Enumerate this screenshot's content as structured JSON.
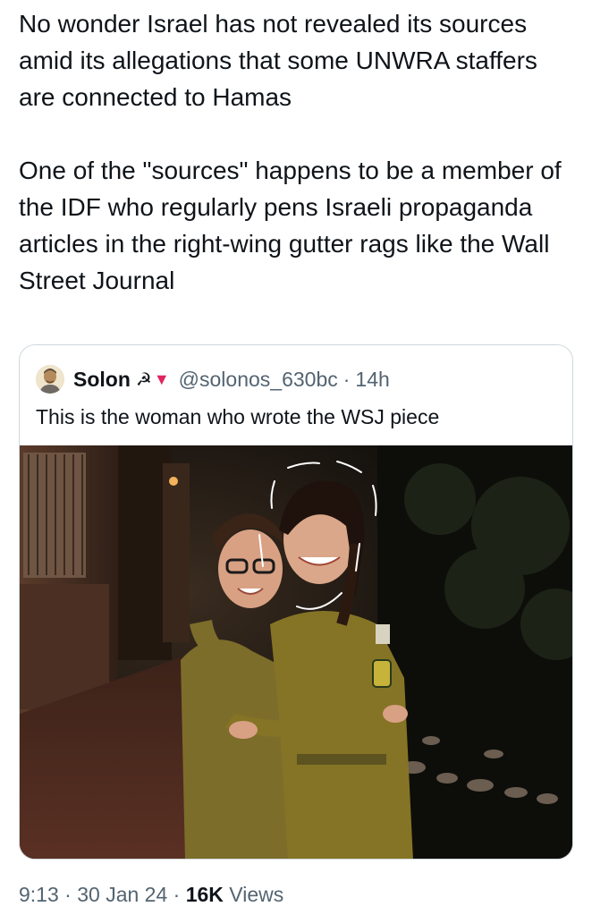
{
  "post": {
    "paragraph_1": "No wonder Israel has not revealed its sources amid its allegations that some UNWRA staffers are connected to Hamas",
    "paragraph_2": "One of the \"sources\" happens to be a member of the IDF who regularly pens Israeli propaganda articles in the right-wing gutter rags like the Wall Street Journal"
  },
  "quote": {
    "author_name": "Solon",
    "flair_symbols": "☭",
    "flair_triangle": "▼",
    "handle": "@solonos_630bc",
    "separator": "·",
    "time": "14h",
    "text": "This is the woman who wrote the WSJ piece",
    "image_icon": "photo-of-two-soldiers-hugging"
  },
  "meta": {
    "time": "9:13",
    "separator_1": "·",
    "date": "30 Jan 24",
    "separator_2": "·",
    "views_count": "16K",
    "views_label": "Views"
  },
  "colors": {
    "text_primary": "#0f1419",
    "text_secondary": "#536471",
    "border": "#cfd9de",
    "flair_red": "#e0245e",
    "uniform_olive": "#8a7a2e"
  }
}
